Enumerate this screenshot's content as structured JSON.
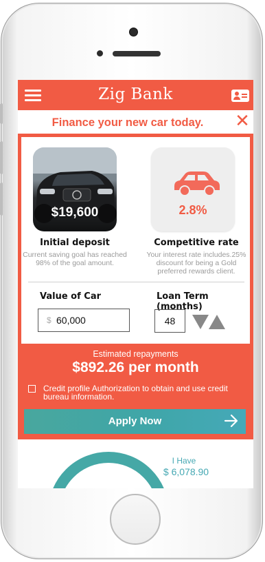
{
  "app": {
    "title": "Zig Bank"
  },
  "promo": {
    "text": "Finance your new car today."
  },
  "deposit": {
    "amount": "$19,600",
    "title": "Initial deposit",
    "description": "Current saving goal has reached 98% of the goal amount."
  },
  "rate": {
    "value": "2.8%",
    "title": "Competitive rate",
    "description": "Your interest rate includes.25% discount for being a Gold preferred rewards client."
  },
  "car_value": {
    "label": "Value of Car",
    "currency": "$",
    "value": "60,000"
  },
  "loan_term": {
    "label": "Loan Term (months)",
    "value": "48"
  },
  "estimate": {
    "label": "Estimated repayments",
    "value": "$892.26 per month"
  },
  "authorization": {
    "text": "Credit profile Authorization to obtain and use credit bureau information.",
    "checked": false
  },
  "apply": {
    "label": "Apply Now"
  },
  "savings": {
    "label": "I Have",
    "value": "$ 6,078.90"
  },
  "colors": {
    "brand": "#f15b44",
    "accent": "#45a8a6",
    "text_muted": "#9a9a9a"
  },
  "icons": [
    "menu-icon",
    "contact-card-icon",
    "close-icon",
    "car-icon",
    "chevron-down-icon",
    "chevron-up-icon",
    "arrow-right-icon"
  ]
}
